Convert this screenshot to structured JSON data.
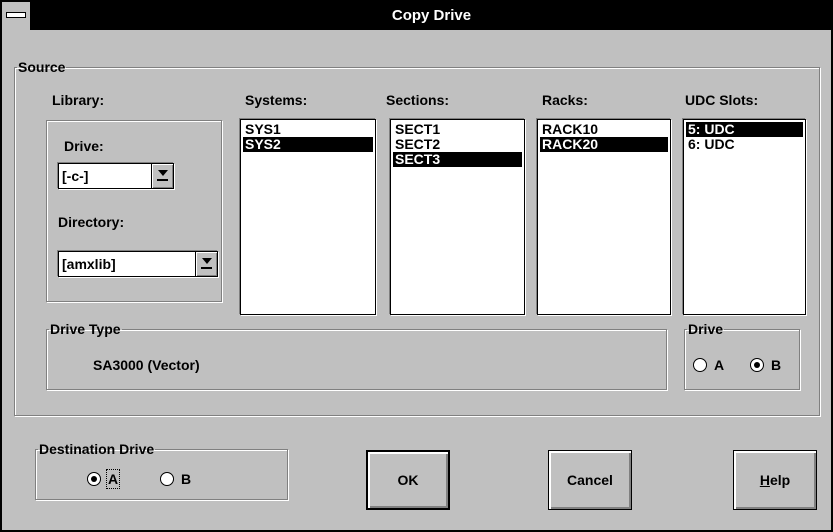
{
  "window": {
    "title": "Copy Drive"
  },
  "source": {
    "legend": "Source",
    "library": {
      "label": "Library:",
      "drive_label": "Drive:",
      "drive_value": "[-c-]",
      "directory_label": "Directory:",
      "directory_value": "[amxlib]"
    },
    "systems": {
      "label": "Systems:",
      "items": [
        "SYS1",
        "SYS2"
      ],
      "selected": 1
    },
    "sections": {
      "label": "Sections:",
      "items": [
        "SECT1",
        "SECT2",
        "SECT3"
      ],
      "selected": 2
    },
    "racks": {
      "label": "Racks:",
      "items": [
        "RACK10",
        "RACK20"
      ],
      "selected": 1
    },
    "udc_slots": {
      "label": "UDC Slots:",
      "items": [
        "5: UDC",
        "6: UDC"
      ],
      "selected": 0
    },
    "drive_type": {
      "legend": "Drive Type",
      "value": "SA3000 (Vector)"
    },
    "drive": {
      "legend": "Drive",
      "option_a": "A",
      "option_b": "B",
      "selected": "B"
    }
  },
  "destination": {
    "legend": "Destination Drive",
    "option_a": "A",
    "option_b": "B",
    "selected": "A"
  },
  "buttons": {
    "ok": "OK",
    "cancel": "Cancel",
    "help_mnemonic": "H",
    "help_rest": "elp"
  }
}
